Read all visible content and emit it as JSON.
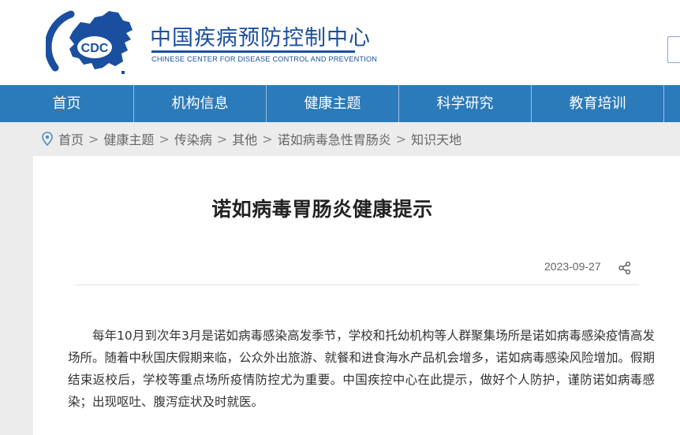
{
  "header": {
    "logo_text": "CDC",
    "name_cn": "中国疾病预防控制中心",
    "name_en": "CHINESE CENTER FOR DISEASE CONTROL AND PREVENTION",
    "brand_color": "#1a4fa0"
  },
  "nav": {
    "items": [
      {
        "label": "首页"
      },
      {
        "label": "机构信息"
      },
      {
        "label": "健康主题"
      },
      {
        "label": "科学研究"
      },
      {
        "label": "教育培训"
      }
    ],
    "background_color": "#2b7ab9"
  },
  "breadcrumb": {
    "icon": "location-pin-icon",
    "items": [
      "首页",
      "健康主题",
      "传染病",
      "其他",
      "诺如病毒急性胃肠炎",
      "知识天地"
    ],
    "separator": ">"
  },
  "article": {
    "title": "诺如病毒胃肠炎健康提示",
    "date": "2023-09-27",
    "share_icon": "share-icon",
    "paragraph": "每年10月到次年3月是诺如病毒感染高发季节，学校和托幼机构等人群聚集场所是诺如病毒感染疫情高发场所。随着中秋国庆假期来临，公众外出旅游、就餐和进食海水产品机会增多，诺如病毒感染风险增加。假期结束返校后，学校等重点场所疫情防控尤为重要。中国疾控中心在此提示，做好个人防护，谨防诺如病毒感染；出现呕吐、腹泻症状及时就医。"
  }
}
